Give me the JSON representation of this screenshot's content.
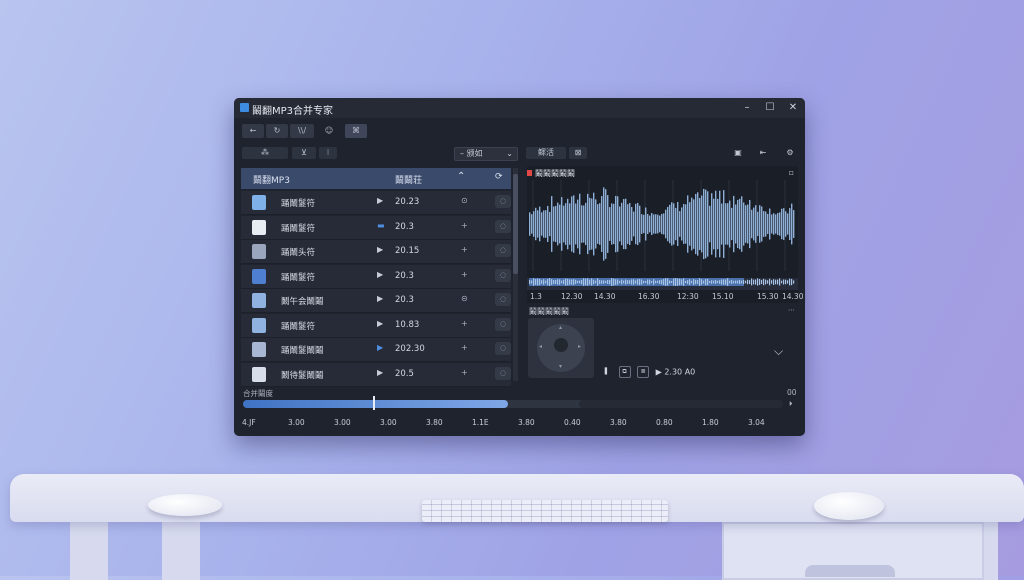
{
  "window": {
    "title": "鬫翻MP3合并专家",
    "controls": [
      "–",
      "☐",
      "✕"
    ]
  },
  "toolbar": {
    "row1": [
      "←",
      "↻",
      "\\\\/",
      "☺",
      "⌘"
    ],
    "row2": [
      "⁂",
      "⊻",
      "⁝"
    ],
    "dropdown_value": "– 颁如",
    "sort_label": "鳏活",
    "right_icons": [
      "▣",
      "⇤",
      "⚙"
    ]
  },
  "list": {
    "header_name": "鬫翻MP3",
    "header_size": "鬫鬫荘",
    "rows": [
      {
        "name": "踊鬫鬉符",
        "size": "20.23",
        "icon_color": "#7fb0e8"
      },
      {
        "name": "踊鬫鬉符",
        "size": "20.3",
        "icon_color": "#e8ecf3"
      },
      {
        "name": "踊鬫头符",
        "size": "20.15",
        "icon_color": "#9aa6bd"
      },
      {
        "name": "踊鬫鬉符",
        "size": "20.3",
        "icon_color": "#4f7fd0"
      },
      {
        "name": "鬫午会鬫鬮",
        "size": "20.3",
        "icon_color": "#8fb2e0"
      },
      {
        "name": "踊鬫鬉符",
        "size": "10.83",
        "icon_color": "#8fb2e0"
      },
      {
        "name": "踊鬫鬉鬫鬮",
        "size": "202.30",
        "icon_color": "#a7b6d3"
      },
      {
        "name": "鬫待鬉鬫鬮",
        "size": "20.5",
        "icon_color": "#d7deea"
      }
    ]
  },
  "waveform": {
    "title": "鬫鬫鬫鬫鬫",
    "timeline": [
      "1.3",
      "12.30",
      "14.30",
      "16.30",
      "12:30",
      "15.10",
      "15.30",
      "14.30"
    ]
  },
  "preview": {
    "label": "鬫鬫鬫鬫鬫",
    "time": "▶ 2.30 A0"
  },
  "progress": {
    "label": "合并鬫度",
    "end_label": "00",
    "value": 0.49,
    "ticks": [
      "4.JF",
      "3.00",
      "3.00",
      "3.00",
      "3.80",
      "1.1E",
      "3.80",
      "0.40",
      "3.80",
      "0.80",
      "1.80",
      "3.04"
    ]
  },
  "colors": {
    "accent": "#3f73c4",
    "waveform": "#8fb0d6",
    "window_bg": "#1f232e"
  }
}
